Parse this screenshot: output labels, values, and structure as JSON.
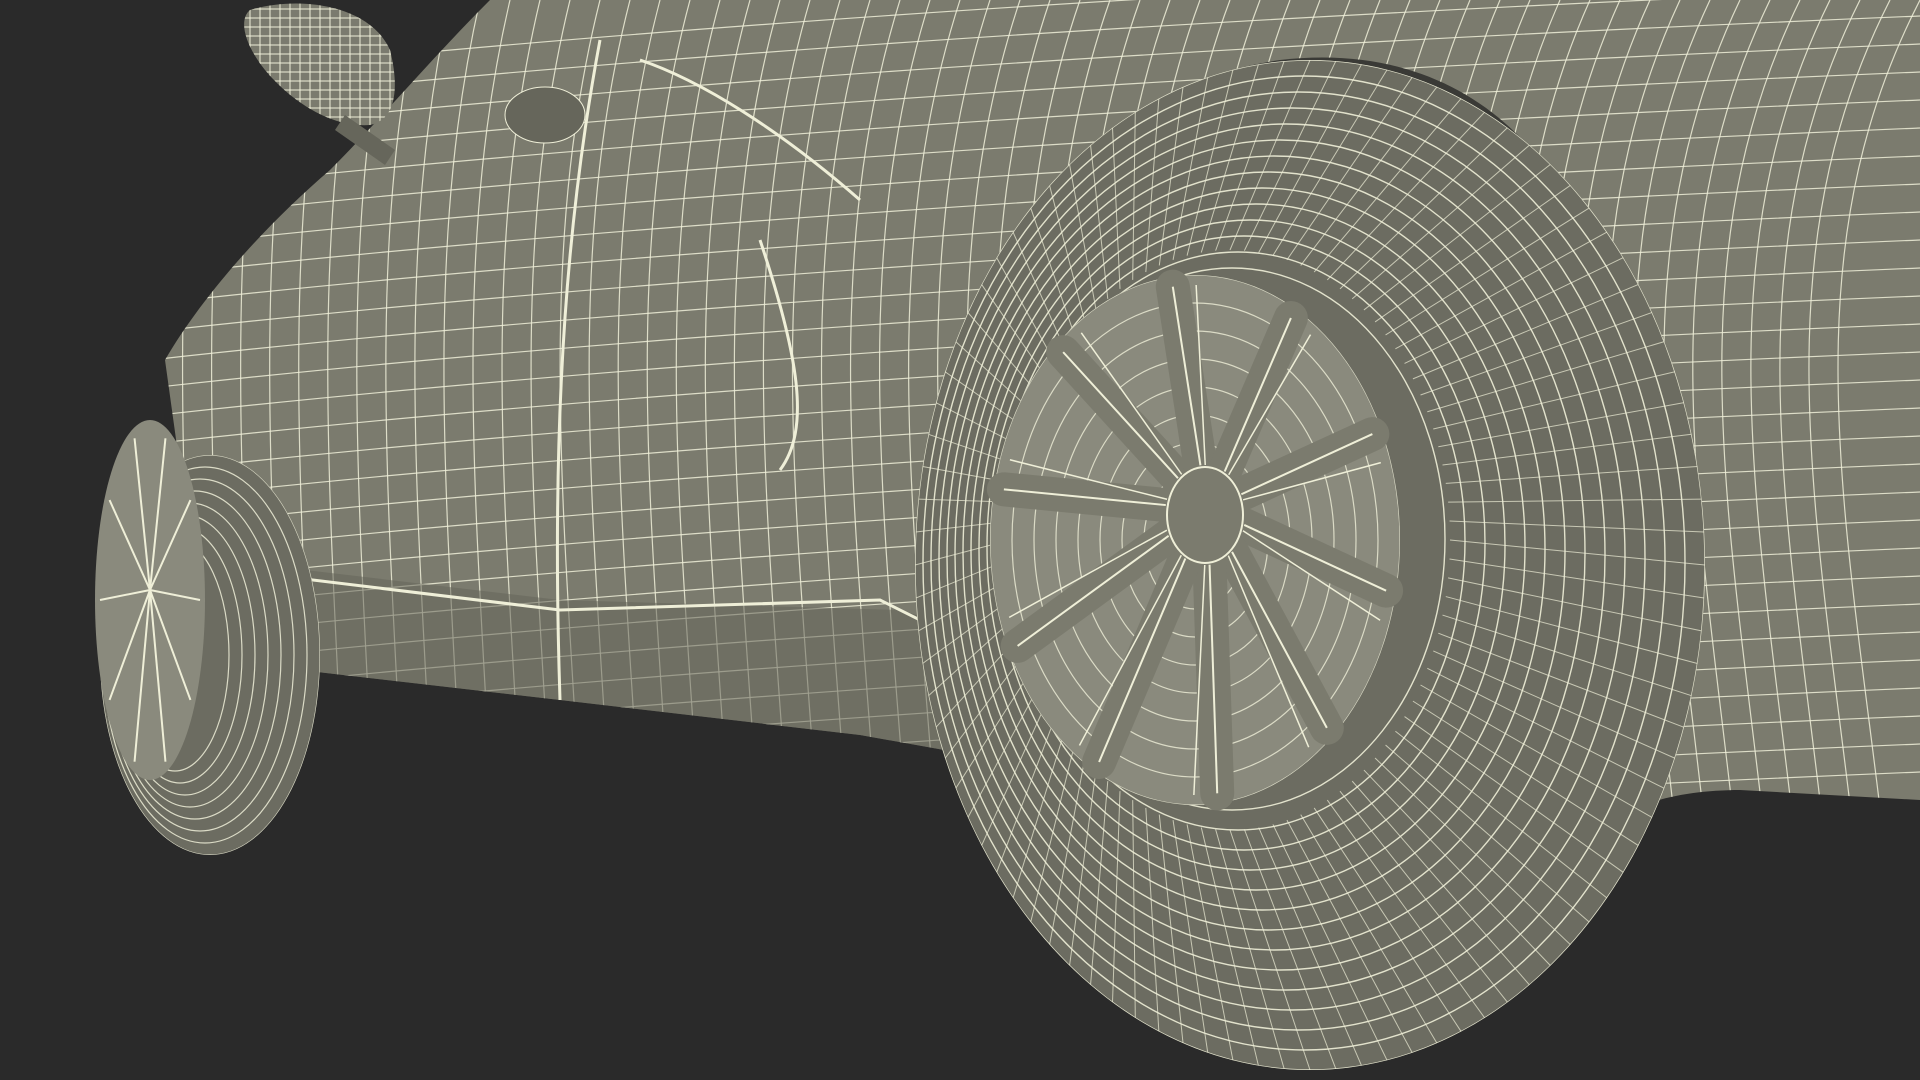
{
  "scene": {
    "subject": "car-wireframe",
    "colors": {
      "background": "#2a2a2a",
      "surface": "#7b7b6e",
      "surface_dark": "#66665b",
      "surface_light": "#8a8a7d",
      "wire": "#efefd8",
      "tire": "#6c6c61",
      "wheel_well": "#3a3a36",
      "shadow": "#55554c"
    }
  }
}
